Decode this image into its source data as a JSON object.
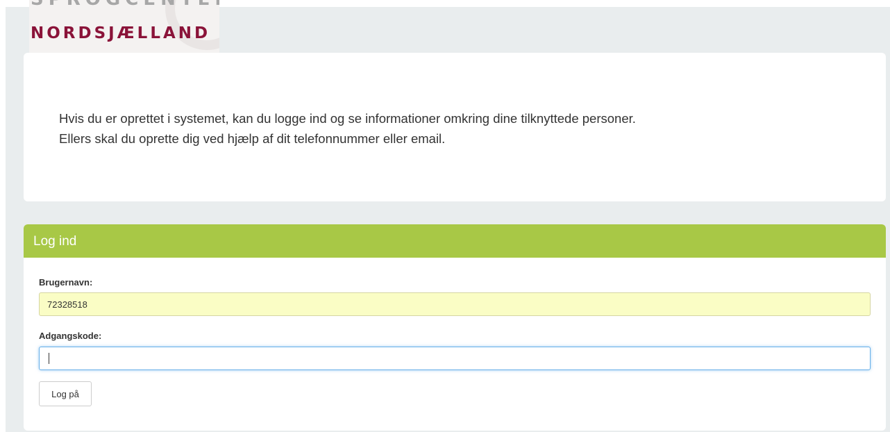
{
  "logo": {
    "line1": "SPROGCENTER",
    "line2": "NORDSJÆLLAND",
    "colors": {
      "line1": "#a7a7a7",
      "line2": "#8a1339"
    }
  },
  "info": {
    "line1": "Hvis du er oprettet i systemet, kan du logge ind og se informationer omkring dine tilknyttede personer.",
    "line2": "Ellers skal du oprette dig ved hjælp af dit telefonnummer eller email."
  },
  "login": {
    "header": "Log ind",
    "header_color": "#a8c846",
    "username_label": "Brugernavn:",
    "username_value": "72328518",
    "password_label": "Adgangskode:",
    "password_value": "",
    "submit_label": "Log på"
  }
}
